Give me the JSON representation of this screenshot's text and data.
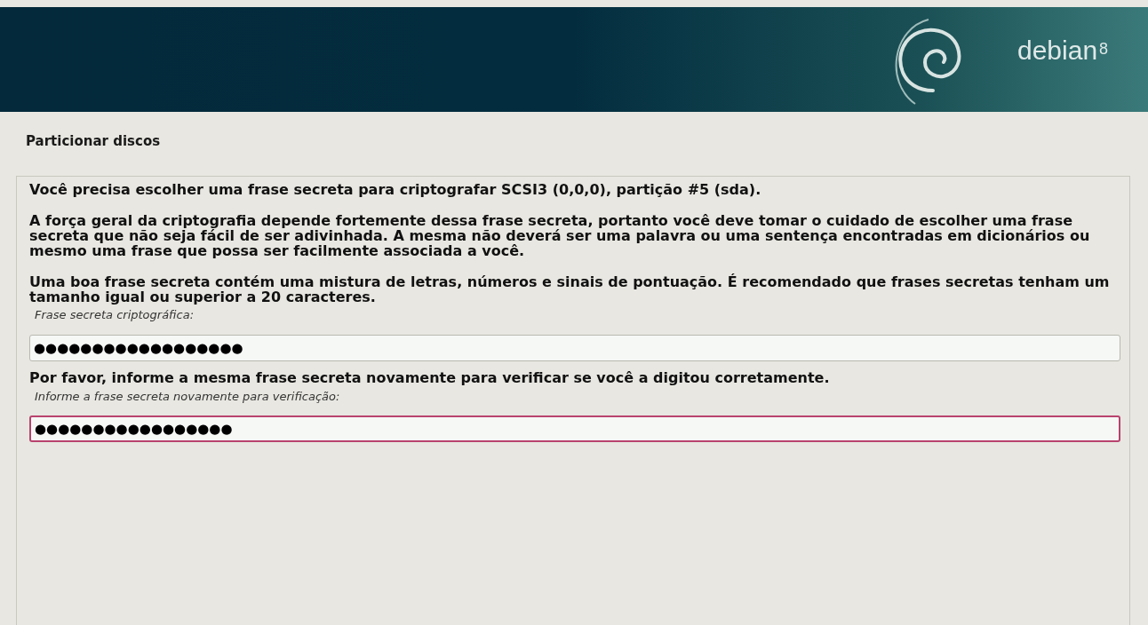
{
  "banner": {
    "logo_text": "debian",
    "version": "8"
  },
  "title": "Particionar discos",
  "paragraphs": [
    "Você precisa escolher uma frase secreta para criptografar SCSI3 (0,0,0), partição #5 (sda).",
    "A força geral da criptografia depende fortemente dessa frase secreta, portanto você deve tomar o cuidado de escolher uma frase secreta que não seja fácil de ser adivinhada. A mesma não deverá ser uma palavra ou uma sentença encontradas em dicionários ou mesmo uma frase que possa ser facilmente associada a você.",
    "Uma boa frase secreta contém uma mistura de letras, números e sinais de pontuação. É recomendado que frases secretas tenham um tamanho igual ou superior a 20 caracteres."
  ],
  "fields": [
    {
      "label": "Frase secreta criptográfica:",
      "value": "●●●●●●●●●●●●●●●●●●",
      "focused": false
    },
    {
      "prompt": "Por favor, informe a mesma frase secreta novamente para verificar se você a digitou corretamente.",
      "label": "Informe a frase secreta novamente para verificação:",
      "value": "●●●●●●●●●●●●●●●●●",
      "focused": true
    }
  ]
}
